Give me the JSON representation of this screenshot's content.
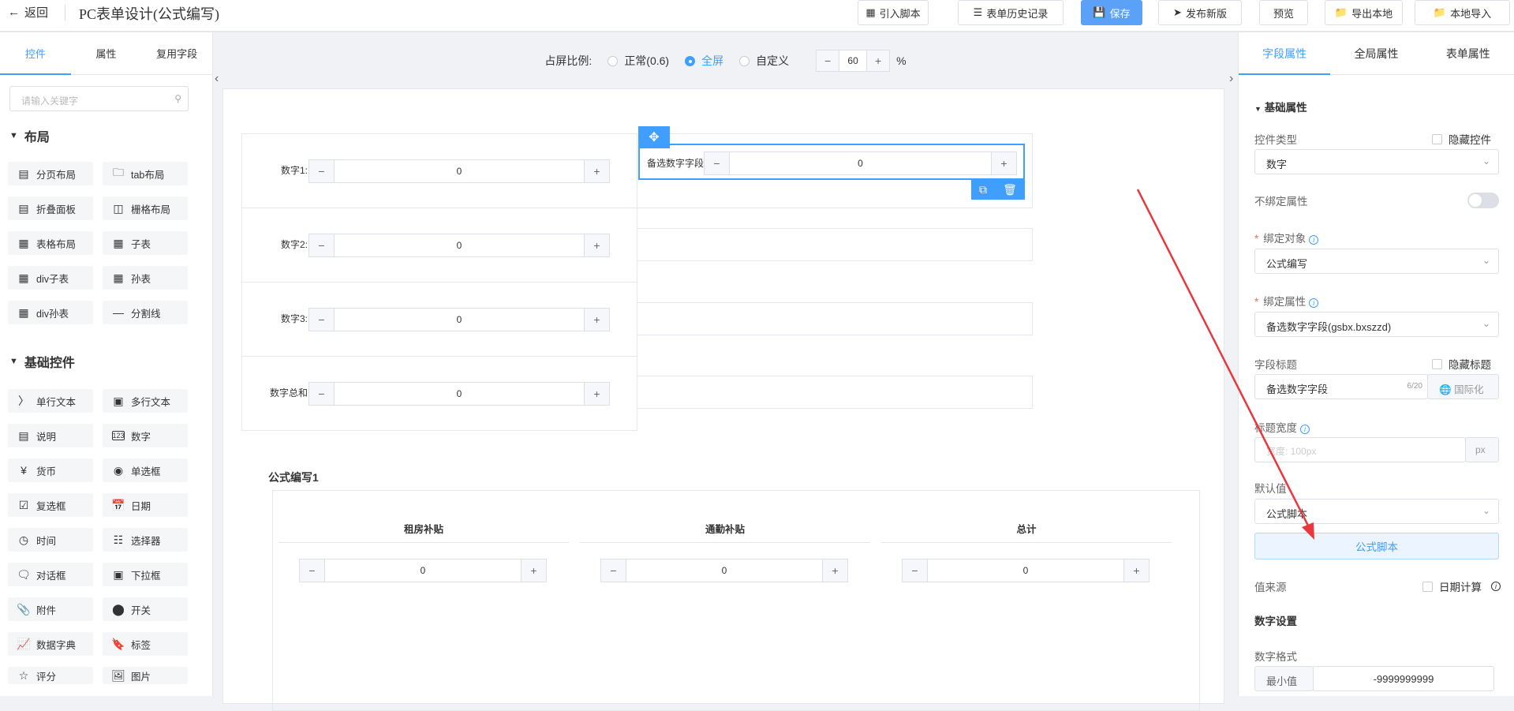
{
  "topbar": {
    "back_label": "返回",
    "title": "PC表单设计(公式编写)",
    "buttons": [
      "引入脚本",
      "表单历史记录",
      "保存",
      "发布新版",
      "预览",
      "导出本地",
      "本地导入"
    ]
  },
  "left": {
    "tabs": [
      "控件",
      "属性",
      "复用字段"
    ],
    "search_placeholder": "请输入关键字",
    "layout_group": "布局",
    "layout_items": [
      "分页布局",
      "tab布局",
      "折叠面板",
      "栅格布局",
      "表格布局",
      "子表",
      "div子表",
      "孙表",
      "div孙表",
      "分割线"
    ],
    "basic_group": "基础控件",
    "basic_items": [
      "单行文本",
      "多行文本",
      "说明",
      "数字",
      "货币",
      "单选框",
      "复选框",
      "日期",
      "时间",
      "选择器",
      "对话框",
      "下拉框",
      "附件",
      "开关",
      "数据字典",
      "标签",
      "评分",
      "图片"
    ]
  },
  "mid": {
    "ratio_label": "占屏比例:",
    "options": [
      "正常(0.6)",
      "全屏",
      "自定义"
    ],
    "zoom_value": "60",
    "zoom_unit": "%",
    "fields": [
      {
        "label": "数字1:",
        "value": "0"
      },
      {
        "label": "数字2:",
        "value": "0"
      },
      {
        "label": "数字3:",
        "value": "0"
      },
      {
        "label": "数字总和:",
        "value": "0"
      }
    ],
    "selected_field": {
      "label": "备选数字字段:",
      "value": "0"
    },
    "section_title": "公式编写1",
    "columns": [
      {
        "header": "租房补贴",
        "value": "0"
      },
      {
        "header": "通勤补贴",
        "value": "0"
      },
      {
        "header": "总计",
        "value": "0"
      }
    ]
  },
  "right": {
    "tabs": [
      "字段属性",
      "全局属性",
      "表单属性"
    ],
    "basic_section": "基础属性",
    "control_type_label": "控件类型",
    "hide_control": "隐藏控件",
    "control_type_value": "数字",
    "unbound_label": "不绑定属性",
    "bind_object_label": "绑定对象",
    "bind_object_value": "公式编写",
    "bind_attr_label": "绑定属性",
    "bind_attr_value": "备选数字字段(gsbx.bxszzd)",
    "field_title_label": "字段标题",
    "hide_title": "隐藏标题",
    "field_title_value": "备选数字字段",
    "field_title_count": "6/20",
    "i18n": "国际化",
    "title_width_label": "标题宽度",
    "title_width_placeholder": "宽度: 100px",
    "title_width_unit": "px",
    "default_label": "默认值",
    "default_value": "公式脚本",
    "formula_button": "公式脚本",
    "source_label": "值来源",
    "date_calc": "日期计算",
    "number_settings": "数字设置",
    "number_format": "数字格式",
    "min_label": "最小值",
    "min_value": "-9999999999"
  }
}
